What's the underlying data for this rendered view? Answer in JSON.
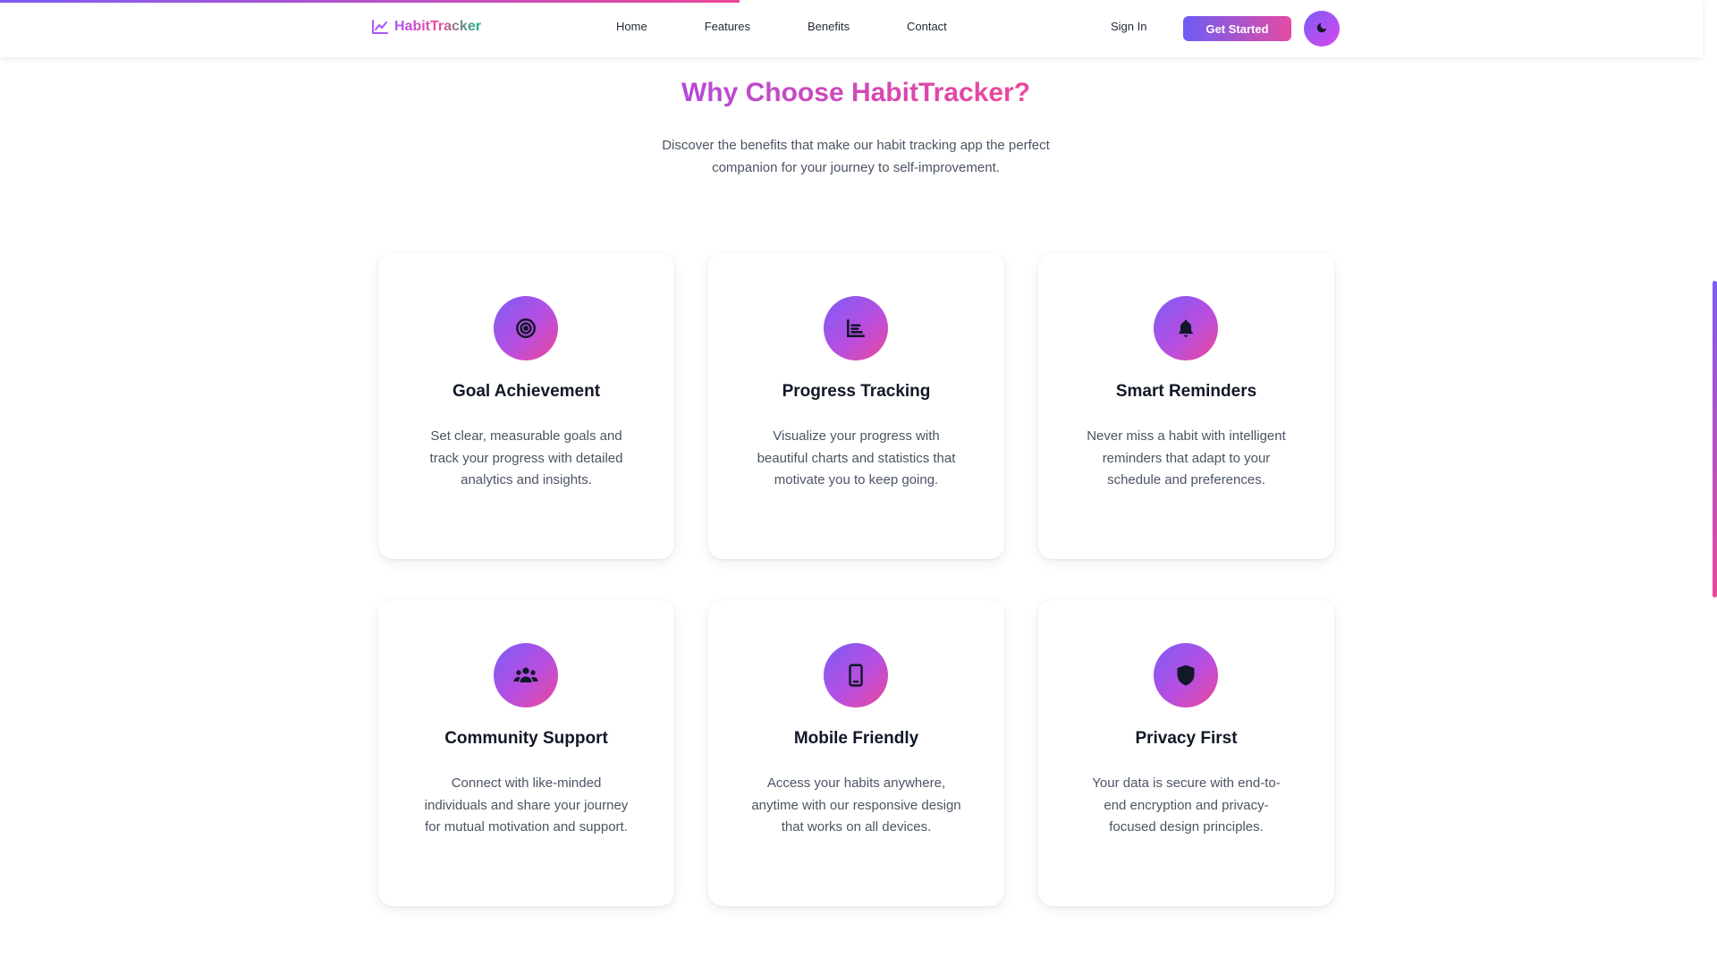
{
  "header": {
    "logo_text": "HabitTracker",
    "nav": [
      "Home",
      "Features",
      "Benefits",
      "Contact"
    ],
    "sign_in": "Sign In",
    "cta": "Get Started",
    "theme_toggle_icon": "moon-icon"
  },
  "section": {
    "title": "Why Choose HabitTracker?",
    "subtitle": "Discover the benefits that make our habit tracking app the perfect companion for your journey to self-improvement."
  },
  "cards": [
    {
      "icon": "target-icon",
      "title": "Goal Achievement",
      "description": "Set clear, measurable goals and track your progress with detailed analytics and insights."
    },
    {
      "icon": "chart-icon",
      "title": "Progress Tracking",
      "description": "Visualize your progress with beautiful charts and statistics that motivate you to keep going."
    },
    {
      "icon": "bell-icon",
      "title": "Smart Reminders",
      "description": "Never miss a habit with intelligent reminders that adapt to your schedule and preferences."
    },
    {
      "icon": "users-icon",
      "title": "Community Support",
      "description": "Connect with like-minded individuals and share your journey for mutual motivation and support."
    },
    {
      "icon": "mobile-icon",
      "title": "Mobile Friendly",
      "description": "Access your habits anywhere, anytime with our responsive design that works on all devices."
    },
    {
      "icon": "shield-icon",
      "title": "Privacy First",
      "description": "Your data is secure with end-to-end encryption and privacy-focused design principles."
    }
  ],
  "colors": {
    "accent_start": "#7c5cf6",
    "accent_end": "#ec4899",
    "logo_end": "#10b981"
  }
}
